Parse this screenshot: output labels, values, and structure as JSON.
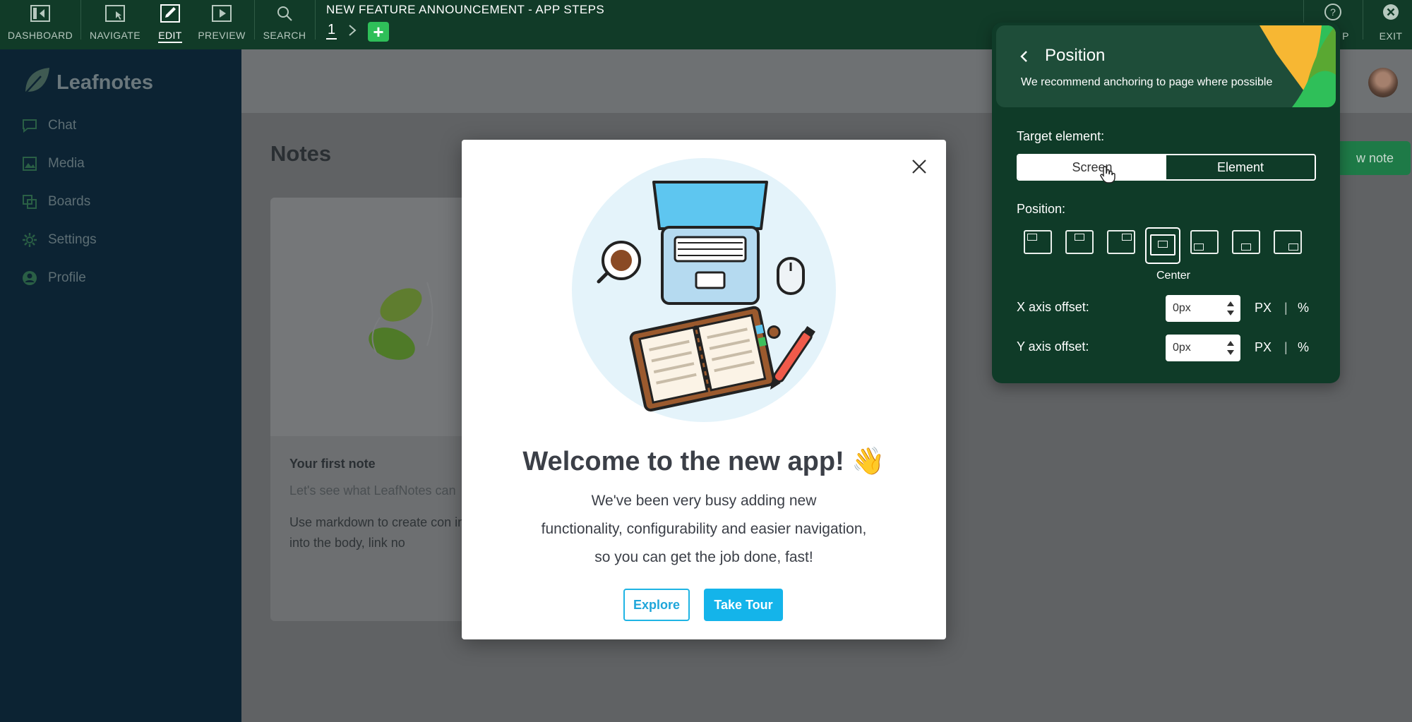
{
  "toolbar": {
    "tools": [
      {
        "name": "dashboard",
        "label": "DASHBOARD",
        "icon": "dashboard-icon"
      },
      {
        "name": "navigate",
        "label": "NAVIGATE",
        "icon": "navigate-icon"
      },
      {
        "name": "edit",
        "label": "EDIT",
        "icon": "edit-icon",
        "active": true
      },
      {
        "name": "preview",
        "label": "PREVIEW",
        "icon": "preview-icon"
      },
      {
        "name": "search",
        "label": "SEARCH",
        "icon": "search-icon"
      }
    ],
    "flow_title": "NEW FEATURE ANNOUNCEMENT - APP STEPS",
    "current_step": "1",
    "add_step": "+",
    "help_label": "P",
    "exit_label": "EXIT"
  },
  "app": {
    "logo_text": "Leafnotes",
    "sidebar": [
      {
        "label": "Chat",
        "icon": "chat-icon"
      },
      {
        "label": "Media",
        "icon": "media-icon"
      },
      {
        "label": "Boards",
        "icon": "boards-icon"
      },
      {
        "label": "Settings",
        "icon": "settings-gear-icon"
      },
      {
        "label": "Profile",
        "icon": "profile-icon"
      }
    ],
    "page_title": "Notes",
    "new_note_label": "w note",
    "note": {
      "title": "Your first note",
      "subtitle": "Let's see what LeafNotes can",
      "body": "Use markdown to create con images into the body, link no"
    }
  },
  "modal": {
    "title": "Welcome to the new app! 👋",
    "body_lines": [
      "We've been very busy adding new",
      "functionality, configurability and easier navigation,",
      "so you can get the job done, fast!"
    ],
    "explore_label": "Explore",
    "tour_label": "Take Tour",
    "colors": {
      "primary": "#14b4ea"
    }
  },
  "panel": {
    "title": "Position",
    "subtitle": "We recommend anchoring to page where possible",
    "target_label": "Target element:",
    "target_options": [
      "Screen",
      "Element"
    ],
    "target_selected": "Screen",
    "position_label": "Position:",
    "positions": [
      "top-left",
      "top-center",
      "top-right",
      "center",
      "bottom-left",
      "bottom-center",
      "bottom-right"
    ],
    "selected_position": "Center",
    "x_label": "X axis offset:",
    "x_value": "0px",
    "y_label": "Y axis offset:",
    "y_value": "0px",
    "unit_px": "PX",
    "unit_sep": "|",
    "unit_pct": "%",
    "colors": {
      "panel_bg": "#0f3b28",
      "accent_yellow": "#f7b733",
      "accent_green": "#2fbf59"
    }
  }
}
